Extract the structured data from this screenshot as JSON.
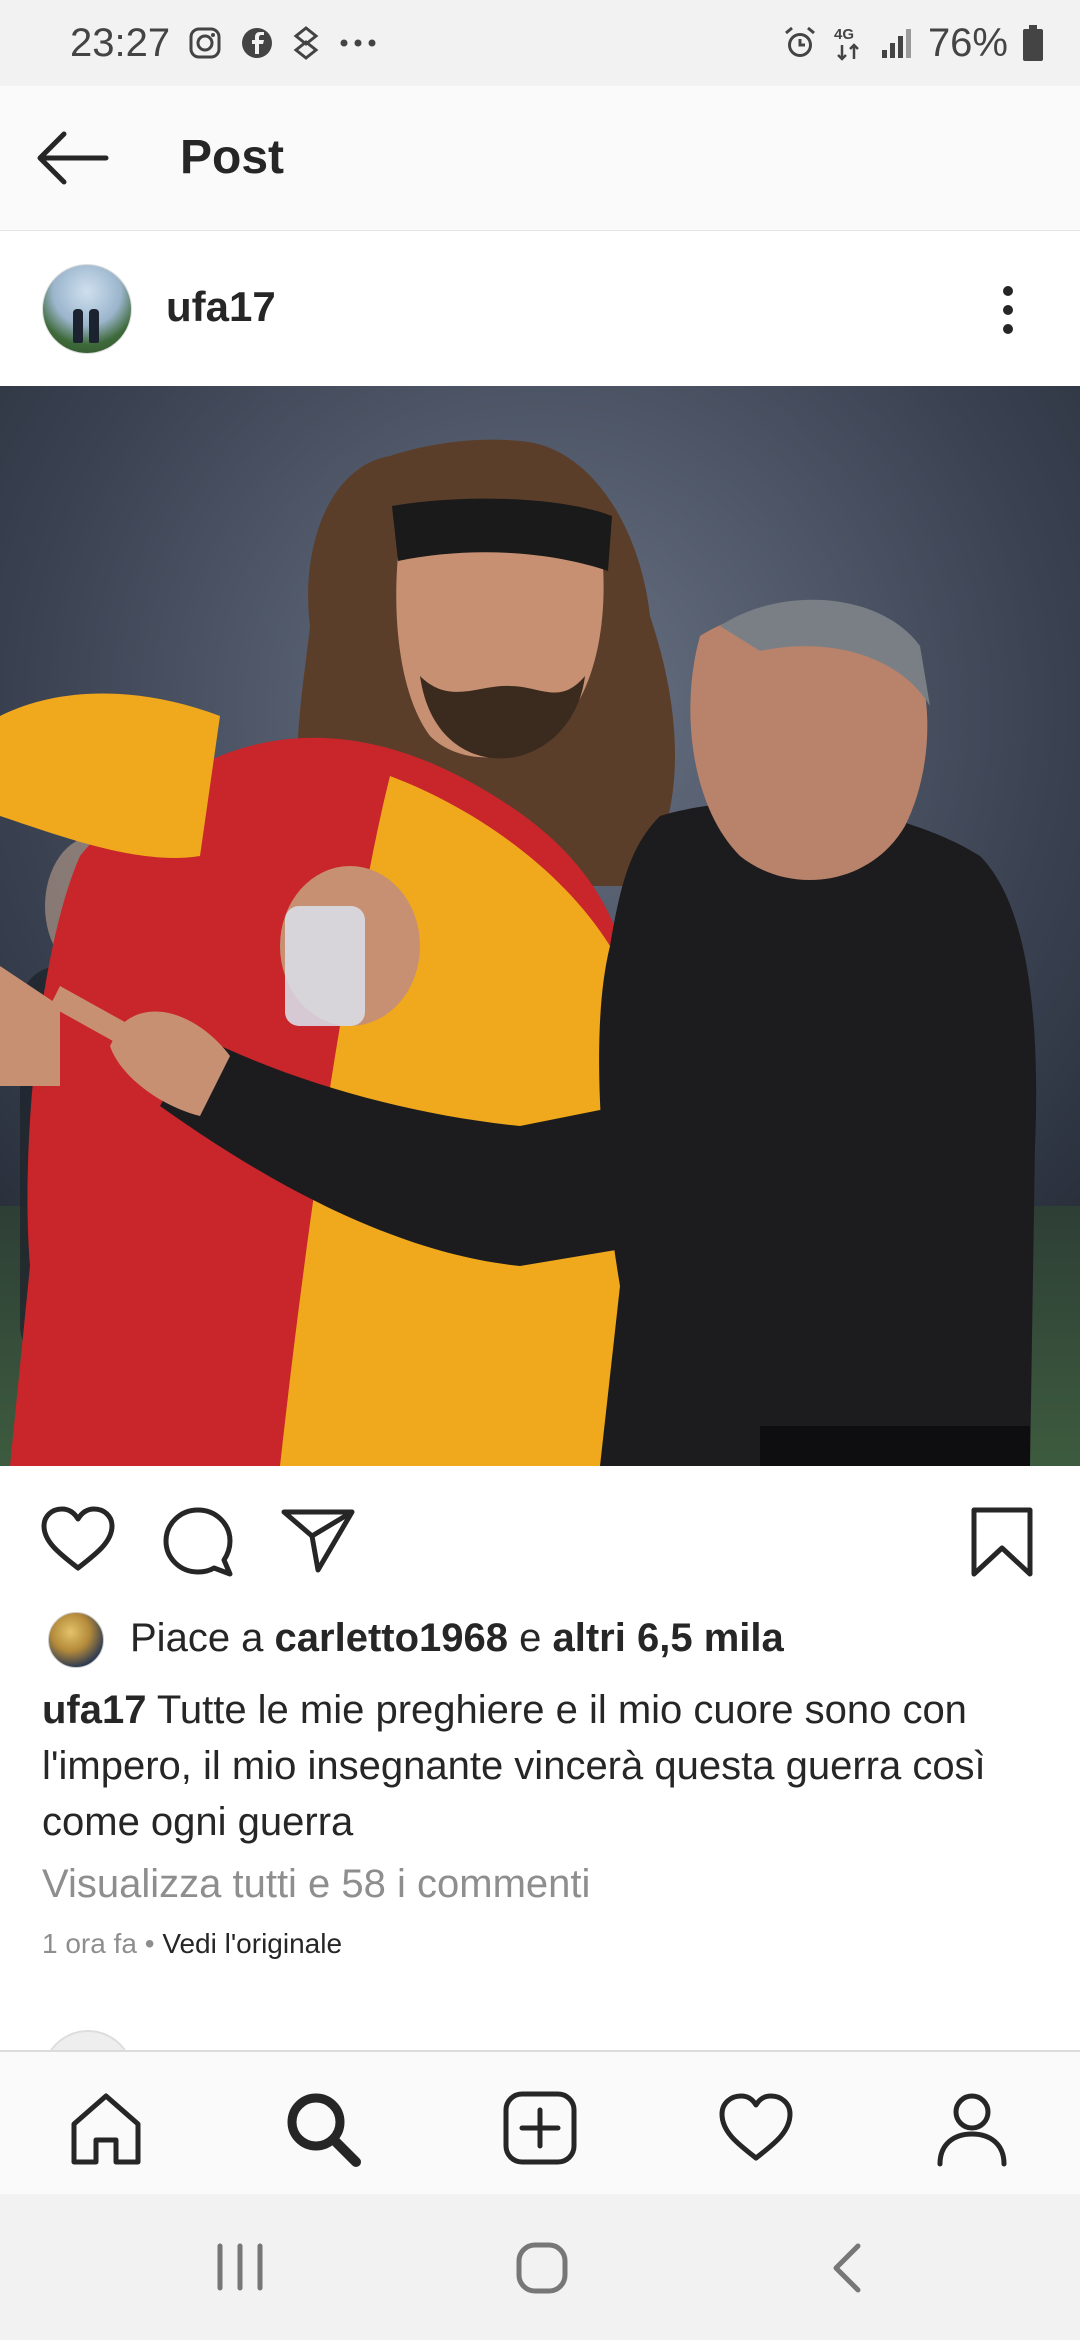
{
  "status_bar": {
    "time": "23:27",
    "left_icons": [
      "instagram-icon",
      "facebook-icon",
      "app-notification-icon",
      "more-notifications-icon"
    ],
    "network": "4G",
    "battery": "76%"
  },
  "header": {
    "back_icon": "arrow-left-icon",
    "title": "Post"
  },
  "post": {
    "username": "ufa17",
    "image_description_icon": "photo",
    "actions": [
      "heart-icon",
      "comment-icon",
      "share-icon",
      "bookmark-icon"
    ],
    "likes": {
      "prefix": "Piace a ",
      "user": "carletto1968",
      "middle": " e ",
      "others": "altri 6,5 mila"
    },
    "caption": {
      "username": "ufa17",
      "text": " Tutte le mie preghiere e il mio cuore sono con l'impero, il mio insegnante vincerà questa guerra così come ogni guerra"
    },
    "comments_link": "Visualizza tutti e 58 i commenti",
    "time_ago": "1 ora fa",
    "separator": " • ",
    "see_original": "Vedi l'originale"
  },
  "bottom_nav": [
    "home-icon",
    "search-icon",
    "new-post-icon",
    "activity-heart-icon",
    "profile-icon"
  ],
  "system_nav": [
    "recents-icon",
    "home-circle-icon",
    "back-chevron-icon"
  ],
  "colors": {
    "text": "#262626",
    "muted": "#8e8e8e",
    "status_bg": "#f2f2f2",
    "jersey_red": "#c8262a",
    "jersey_yellow": "#f0a81c"
  }
}
